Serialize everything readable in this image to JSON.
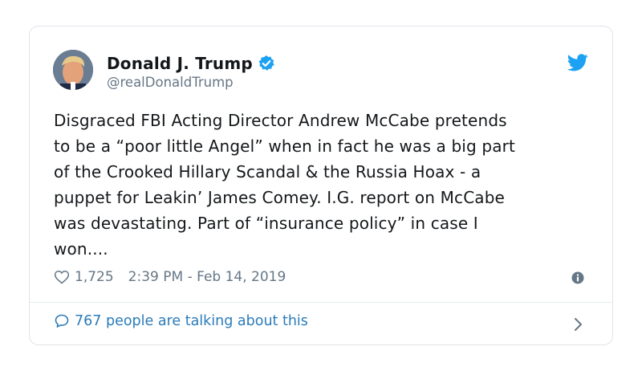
{
  "author": {
    "display_name": "Donald J. Trump",
    "handle": "@realDonaldTrump"
  },
  "tweet": {
    "lines": [
      "Disgraced FBI Acting Director Andrew McCabe pretends",
      "to be a “poor little Angel” when in fact he was a big part",
      "of the Crooked Hillary Scandal & the Russia Hoax - a",
      "puppet for Leakin’ James Comey. I.G. report on McCabe",
      "was devastating. Part of “insurance policy” in case I",
      "won...."
    ]
  },
  "meta": {
    "likes": "1,725",
    "timestamp": "2:39 PM - Feb 14, 2019"
  },
  "conversation": {
    "label": "767 people are talking about this"
  },
  "icons": {
    "verified": "verified-badge-icon",
    "brand": "twitter-bird-icon",
    "like": "heart-icon",
    "info": "info-icon",
    "reply": "speech-bubble-icon",
    "chevron": "chevron-right-icon"
  },
  "colors": {
    "accent": "#1da1f2",
    "link": "#2b7bb9",
    "muted": "#657786",
    "text": "#14171a",
    "border": "#dfe3e8"
  }
}
